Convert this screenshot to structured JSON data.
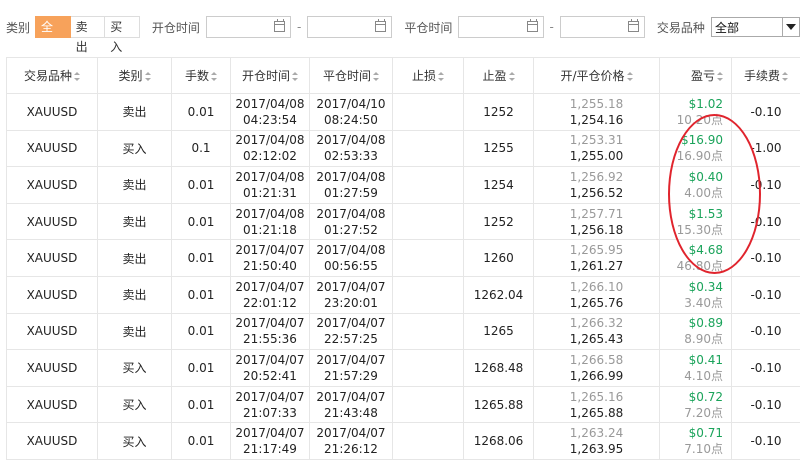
{
  "filters": {
    "type_label": "类别",
    "type_options": [
      "全部",
      "卖出",
      "买入"
    ],
    "type_selected": "全部",
    "open_time_label": "开仓时间",
    "close_time_label": "平仓时间",
    "dash": "-",
    "symbol_label": "交易品种",
    "symbol_selected": "全部"
  },
  "table": {
    "headers": {
      "symbol": "交易品种",
      "type": "类别",
      "lots": "手数",
      "open_time": "开仓时间",
      "close_time": "平仓时间",
      "stop_loss": "止损",
      "take_profit": "止盈",
      "price": "开/平仓价格",
      "pl": "盈亏",
      "fee": "手续费"
    },
    "rows": [
      {
        "symbol": "XAUUSD",
        "type": "卖出",
        "side": "sell",
        "lots": "0.01",
        "open_date": "2017/04/08",
        "open_time": "04:23:54",
        "close_date": "2017/04/10",
        "close_time": "08:24:50",
        "stop_loss": "",
        "take_profit": "1252",
        "open_price": "1,255.18",
        "close_price": "1,254.16",
        "pl": "$1.02",
        "pl_points": "10.20点",
        "fee": "-0.10"
      },
      {
        "symbol": "XAUUSD",
        "type": "买入",
        "side": "buy",
        "lots": "0.1",
        "open_date": "2017/04/08",
        "open_time": "02:12:02",
        "close_date": "2017/04/08",
        "close_time": "02:53:33",
        "stop_loss": "",
        "take_profit": "1255",
        "open_price": "1,253.31",
        "close_price": "1,255.00",
        "pl": "$16.90",
        "pl_points": "16.90点",
        "fee": "-1.00"
      },
      {
        "symbol": "XAUUSD",
        "type": "卖出",
        "side": "sell",
        "lots": "0.01",
        "open_date": "2017/04/08",
        "open_time": "01:21:31",
        "close_date": "2017/04/08",
        "close_time": "01:27:59",
        "stop_loss": "",
        "take_profit": "1254",
        "open_price": "1,256.92",
        "close_price": "1,256.52",
        "pl": "$0.40",
        "pl_points": "4.00点",
        "fee": "-0.10"
      },
      {
        "symbol": "XAUUSD",
        "type": "卖出",
        "side": "sell",
        "lots": "0.01",
        "open_date": "2017/04/08",
        "open_time": "01:21:18",
        "close_date": "2017/04/08",
        "close_time": "01:27:52",
        "stop_loss": "",
        "take_profit": "1252",
        "open_price": "1,257.71",
        "close_price": "1,256.18",
        "pl": "$1.53",
        "pl_points": "15.30点",
        "fee": "-0.10"
      },
      {
        "symbol": "XAUUSD",
        "type": "卖出",
        "side": "sell",
        "lots": "0.01",
        "open_date": "2017/04/07",
        "open_time": "21:50:40",
        "close_date": "2017/04/08",
        "close_time": "00:56:55",
        "stop_loss": "",
        "take_profit": "1260",
        "open_price": "1,265.95",
        "close_price": "1,261.27",
        "pl": "$4.68",
        "pl_points": "46.80点",
        "fee": "-0.10"
      },
      {
        "symbol": "XAUUSD",
        "type": "卖出",
        "side": "sell",
        "lots": "0.01",
        "open_date": "2017/04/07",
        "open_time": "22:01:12",
        "close_date": "2017/04/07",
        "close_time": "23:20:01",
        "stop_loss": "",
        "take_profit": "1262.04",
        "open_price": "1,266.10",
        "close_price": "1,265.76",
        "pl": "$0.34",
        "pl_points": "3.40点",
        "fee": "-0.10"
      },
      {
        "symbol": "XAUUSD",
        "type": "卖出",
        "side": "sell",
        "lots": "0.01",
        "open_date": "2017/04/07",
        "open_time": "21:55:36",
        "close_date": "2017/04/07",
        "close_time": "22:57:25",
        "stop_loss": "",
        "take_profit": "1265",
        "open_price": "1,266.32",
        "close_price": "1,265.43",
        "pl": "$0.89",
        "pl_points": "8.90点",
        "fee": "-0.10"
      },
      {
        "symbol": "XAUUSD",
        "type": "买入",
        "side": "buy",
        "lots": "0.01",
        "open_date": "2017/04/07",
        "open_time": "20:52:41",
        "close_date": "2017/04/07",
        "close_time": "21:57:29",
        "stop_loss": "",
        "take_profit": "1268.48",
        "open_price": "1,266.58",
        "close_price": "1,266.99",
        "pl": "$0.41",
        "pl_points": "4.10点",
        "fee": "-0.10"
      },
      {
        "symbol": "XAUUSD",
        "type": "买入",
        "side": "buy",
        "lots": "0.01",
        "open_date": "2017/04/07",
        "open_time": "21:07:33",
        "close_date": "2017/04/07",
        "close_time": "21:43:48",
        "stop_loss": "",
        "take_profit": "1265.88",
        "open_price": "1,265.16",
        "close_price": "1,265.88",
        "pl": "$0.72",
        "pl_points": "7.20点",
        "fee": "-0.10"
      },
      {
        "symbol": "XAUUSD",
        "type": "买入",
        "side": "buy",
        "lots": "0.01",
        "open_date": "2017/04/07",
        "open_time": "21:17:49",
        "close_date": "2017/04/07",
        "close_time": "21:26:12",
        "stop_loss": "",
        "take_profit": "1268.06",
        "open_price": "1,263.24",
        "close_price": "1,263.95",
        "pl": "$0.71",
        "pl_points": "7.10点",
        "fee": "-0.10"
      }
    ]
  },
  "colors": {
    "accent": "#f7a25b",
    "sell": "#e84c4c",
    "buy": "#2f9e4a",
    "profit": "#1aa35a",
    "annotation_circle": "#e0242d"
  },
  "icons": {
    "calendar": "calendar-icon",
    "dropdown": "chevron-down-icon",
    "sort": "sort-icon"
  }
}
